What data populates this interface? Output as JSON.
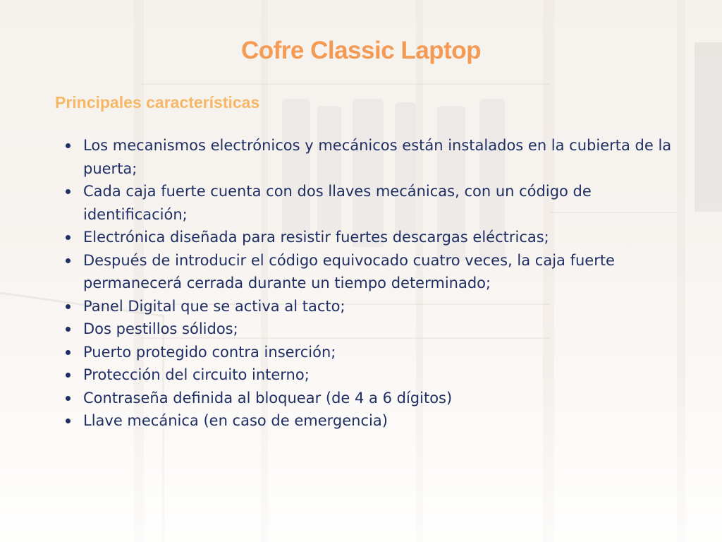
{
  "slide": {
    "title": "Cofre Classic Laptop",
    "subtitle": "Principales características",
    "features": [
      "Los mecanismos electrónicos y mecánicos están instalados en la cubierta de la puerta;",
      "Cada caja fuerte cuenta con dos llaves mecánicas, con un código de identificación;",
      "Electrónica diseñada para resistir fuertes descargas eléctricas;",
      "Después de introducir el código equivocado cuatro veces, la caja fuerte permanecerá cerrada durante un tiempo determinado;",
      "Panel Digital que se activa al tacto;",
      "Dos pestillos sólidos;",
      "Puerto protegido contra inserción;",
      "Protección del circuito interno;",
      "Contraseña definida al bloquear (de 4 a 6 dígitos)",
      "Llave mecánica (en caso de emergencia)"
    ]
  },
  "colors": {
    "title": "#f39a54",
    "subtitle": "#f7b765",
    "body_text": "#1f2f63"
  }
}
